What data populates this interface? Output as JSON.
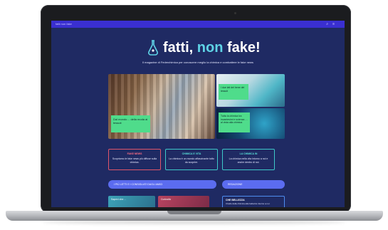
{
  "header": {
    "brand_mini": "fatti non fake",
    "icons": [
      "search-icon",
      "menu-icon"
    ]
  },
  "logo": {
    "part1": "fatti, ",
    "part2": "non",
    "part3": " fake!",
    "accent_color": "#5fd3e6"
  },
  "subtitle": "Il magazine di Federchimica per conoscere meglio la chimica e combattere le fake news",
  "hero": {
    "main_card": "Dal mondo… della moda ai tessuti",
    "top_right_card": "I due lati del bene dei tessuti",
    "bottom_right_card": "Tutta la chimica tra incantesimi e scienza … al vista alla chimica"
  },
  "cards": [
    {
      "title": "FAKE NEWS",
      "desc": "Scopriamo le fake news più diffuse sulla chimica."
    },
    {
      "title": "CHIMICA E VITA",
      "desc": "La chimica è un mondo affascinante tutto da scoprire."
    },
    {
      "title": "LA CHIMICA IN",
      "desc": "La chimica nella vita intorno a noi e anche dentro di noi."
    }
  ],
  "bars": {
    "left": "I PIÙ LETTI E I CONSIGLIATI DAGLI AMICI",
    "right": "REDAZIONE"
  },
  "thumbs": {
    "first": "Sapevi che…",
    "second": "Curiosità"
  },
  "box": {
    "title": "CHE BELLEZZA",
    "desc": "Il bello della chimica alla bellezza intorno a noi"
  },
  "colors": {
    "screen_bg": "#1f2a63",
    "topbar": "#3a2fd1",
    "card_green": "#4fdc8b",
    "pill_blue": "#5b6cf0",
    "red_border": "#e0566a",
    "teal_border": "#3ec9c9"
  }
}
